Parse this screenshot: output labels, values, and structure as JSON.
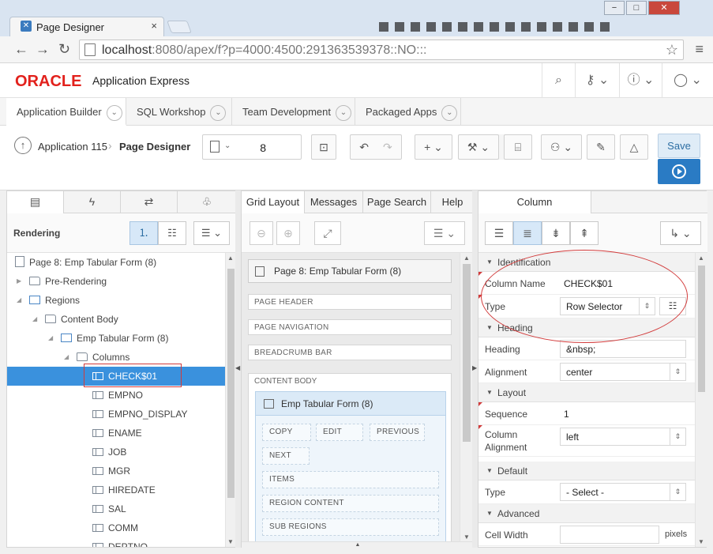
{
  "browser": {
    "tab_title": "Page Designer",
    "tab_close": "×",
    "url_host": "localhost",
    "url_rest": ":8080/apex/f?p=4000:4500:291363539378::NO:::",
    "win_min": "−",
    "win_max": "□",
    "win_close": "✕"
  },
  "apex": {
    "logo": "ORACLE",
    "product": "Application Express",
    "tabs": [
      {
        "label": "Application Builder"
      },
      {
        "label": "SQL Workshop"
      },
      {
        "label": "Team Development"
      },
      {
        "label": "Packaged Apps"
      }
    ]
  },
  "toolbar": {
    "breadcrumb_app": "Application 115",
    "breadcrumb_page": "Page Designer",
    "page_number": "8",
    "go_label": "Go",
    "save_label": "Save"
  },
  "left": {
    "title": "Rendering",
    "tree": [
      {
        "label": "Page 8: Emp Tabular Form (8)"
      },
      {
        "label": "Pre-Rendering"
      },
      {
        "label": "Regions"
      },
      {
        "label": "Content Body"
      },
      {
        "label": "Emp Tabular Form (8)"
      },
      {
        "label": "Columns"
      },
      {
        "label": "CHECK$01"
      },
      {
        "label": "EMPNO"
      },
      {
        "label": "EMPNO_DISPLAY"
      },
      {
        "label": "ENAME"
      },
      {
        "label": "JOB"
      },
      {
        "label": "MGR"
      },
      {
        "label": "HIREDATE"
      },
      {
        "label": "SAL"
      },
      {
        "label": "COMM"
      },
      {
        "label": "DEPTNO"
      }
    ]
  },
  "middle": {
    "tabs": [
      {
        "label": "Grid Layout"
      },
      {
        "label": "Messages"
      },
      {
        "label": "Page Search"
      },
      {
        "label": "Help"
      }
    ],
    "region_title": "Page 8: Emp Tabular Form (8)",
    "region_title_short": "Page 8: Emp Tabular Form (8)",
    "page_header": "PAGE HEADER",
    "page_navigation": "PAGE NAVIGATION",
    "breadcrumb_bar": "BREADCRUMB BAR",
    "content_body": "CONTENT BODY",
    "emp_region": "Emp Tabular Form (8)",
    "slots": {
      "copy": "COPY",
      "edit": "EDIT",
      "previous": "PREVIOUS",
      "next": "NEXT",
      "items": "ITEMS",
      "region_content": "REGION CONTENT",
      "sub_regions": "SUB REGIONS"
    }
  },
  "right": {
    "tab": "Column",
    "groups": {
      "identification": "Identification",
      "heading": "Heading",
      "layout": "Layout",
      "default": "Default",
      "advanced": "Advanced"
    },
    "props": {
      "column_name_label": "Column Name",
      "column_name_value": "CHECK$01",
      "type_label": "Type",
      "type_value": "Row Selector",
      "heading_label": "Heading",
      "heading_value": "&nbsp;",
      "alignment_label": "Alignment",
      "alignment_value": "center",
      "sequence_label": "Sequence",
      "sequence_value": "1",
      "col_align_label_1": "Column",
      "col_align_label_2": "Alignment",
      "col_align_value": "left",
      "default_type_label": "Type",
      "default_type_value": "- Select -",
      "cell_width_label": "Cell Width",
      "cell_width_unit": "pixels"
    }
  }
}
